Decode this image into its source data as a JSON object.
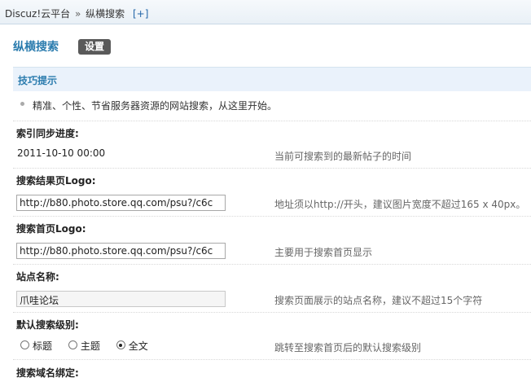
{
  "breadcrumb": {
    "root": "Discuz!云平台",
    "separator": "»",
    "current": "纵横搜索",
    "add": "[+]"
  },
  "page": {
    "title": "纵横搜索",
    "settings_button": "设置"
  },
  "tips": {
    "heading": "技巧提示",
    "items": [
      "精准、个性、节省服务器资源的网站搜索，从这里开始。"
    ]
  },
  "form": {
    "sync_progress": {
      "label": "索引同步进度:",
      "value": "2011-10-10 00:00",
      "description": "当前可搜索到的最新帖子的时间"
    },
    "results_logo": {
      "label": "搜索结果页Logo:",
      "value": "http://b80.photo.store.qq.com/psu?/c6c",
      "description": "地址须以http://开头，建议图片宽度不超过165 x 40px。"
    },
    "home_logo": {
      "label": "搜索首页Logo:",
      "value": "http://b80.photo.store.qq.com/psu?/c6c",
      "description": "主要用于搜索首页显示"
    },
    "site_name": {
      "label": "站点名称:",
      "value": "爪哇论坛",
      "description": "搜索页面展示的站点名称，建议不超过15个字符"
    },
    "default_level": {
      "label": "默认搜索级别:",
      "options": [
        "标题",
        "主题",
        "全文"
      ],
      "selected": "全文",
      "description": "跳转至搜索首页后的默认搜索级别"
    },
    "domain_bind": {
      "label": "搜索域名绑定:"
    }
  }
}
